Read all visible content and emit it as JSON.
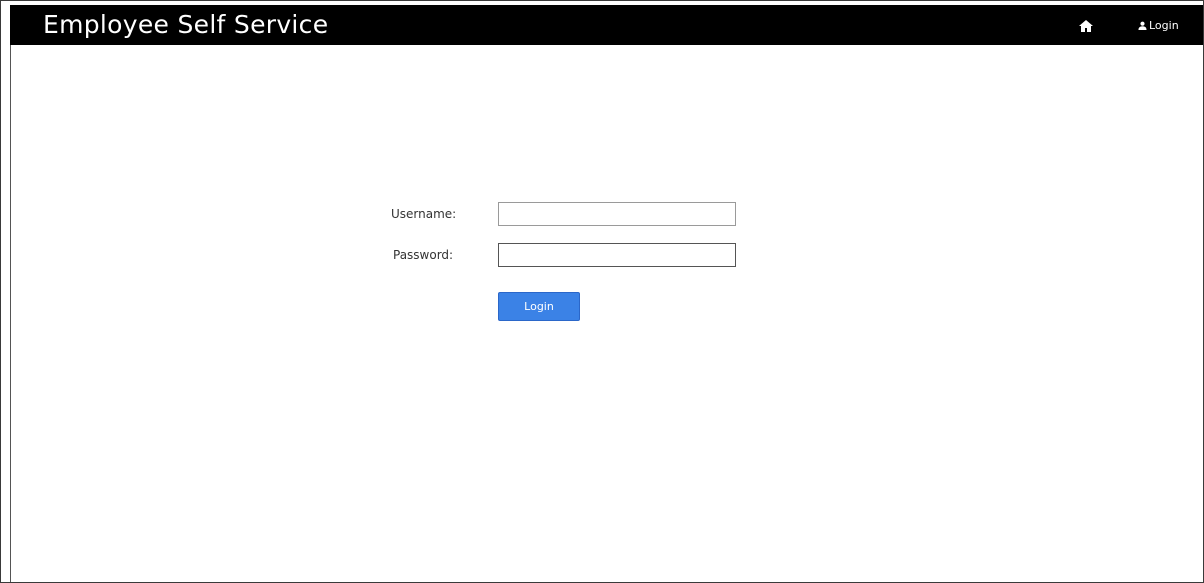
{
  "navbar": {
    "brand": "Employee Self Service",
    "home_icon": "home-icon",
    "login_link": "Login",
    "login_icon": "user-icon"
  },
  "form": {
    "username_label": "Username:",
    "username_value": "",
    "password_label": "Password:",
    "password_value": "",
    "submit_label": "Login"
  },
  "colors": {
    "navbar_bg": "#000000",
    "button_bg": "#3b82e6"
  }
}
